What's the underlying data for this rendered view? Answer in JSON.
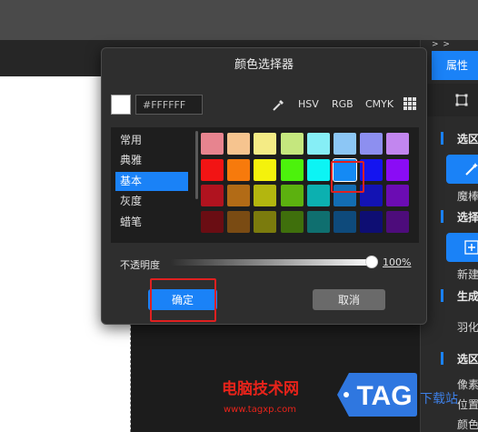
{
  "dialog": {
    "title": "颜色选择器",
    "hex_value": "#FFFFFF",
    "modes": [
      "HSV",
      "RGB",
      "CMYK"
    ],
    "categories": [
      {
        "label": "常用",
        "active": false
      },
      {
        "label": "典雅",
        "active": false
      },
      {
        "label": "基本",
        "active": true
      },
      {
        "label": "灰度",
        "active": false
      },
      {
        "label": "蜡笔",
        "active": false
      }
    ],
    "palette": [
      [
        "#e7848f",
        "#f6c48f",
        "#f4eb85",
        "#c5e77e",
        "#86eef6",
        "#8cc6f5",
        "#8d8ff0",
        "#c286ef"
      ],
      [
        "#f21414",
        "#f77a0c",
        "#f4f20c",
        "#4cf20c",
        "#0cf4f4",
        "#148af5",
        "#1414f0",
        "#8a0cf5"
      ],
      [
        "#b0131f",
        "#b26b16",
        "#b3b60f",
        "#5cb10f",
        "#0cb0b0",
        "#136db3",
        "#1313b3",
        "#6b0cb3"
      ],
      [
        "#6a0d13",
        "#7a4b13",
        "#7b7b0d",
        "#3f6f0c",
        "#0f6f6f",
        "#0e4a7b",
        "#0e0e73",
        "#4d0c7b"
      ]
    ],
    "selected_color": "#148af5",
    "opacity_label": "不透明度",
    "opacity_value": "100%",
    "opacity_fraction": 1.0,
    "ok_label": "确定",
    "cancel_label": "取消"
  },
  "right_panel": {
    "collapse": "> >",
    "tab": "属性",
    "section1": "选区",
    "magic_label": "魔棒",
    "section2": "选择",
    "new_label": "新建",
    "section3": "生成",
    "feather_label": "羽化",
    "section4": "选区",
    "pixel_label": "像素",
    "position_label": "位置",
    "color_label": "颜色"
  },
  "watermark": {
    "site_name": "电脑技术网",
    "url": "www.tagxp.com",
    "tag": "TAG",
    "right_text": "下载站"
  },
  "colors": {
    "accent": "#1a82f7",
    "highlight": "#e02020"
  }
}
